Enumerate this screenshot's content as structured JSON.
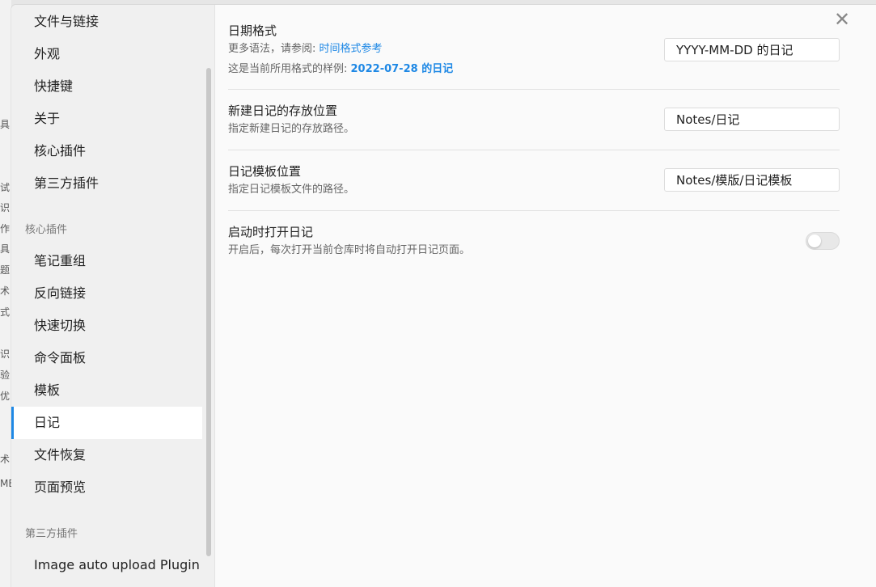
{
  "background_fragments": [
    "具",
    "试",
    "识",
    "作",
    "具",
    "题",
    "术",
    "式",
    "识",
    "验",
    "优",
    "术",
    "ME"
  ],
  "sidebar": {
    "top_items": [
      "文件与链接",
      "外观",
      "快捷键",
      "关于",
      "核心插件",
      "第三方插件"
    ],
    "core_plugins_label": "核心插件",
    "core_plugins": [
      "笔记重组",
      "反向链接",
      "快速切换",
      "命令面板",
      "模板",
      "日记",
      "文件恢复",
      "页面预览"
    ],
    "active_item": "日记",
    "third_party_label": "第三方插件",
    "third_party": [
      "Image auto upload Plugin"
    ]
  },
  "close_icon": "✕",
  "settings": {
    "date_format": {
      "title": "日期格式",
      "desc_prefix": "更多语法，请参阅: ",
      "desc_link": "时间格式参考",
      "sample_prefix": "这是当前所用格式的样例: ",
      "sample_value": "2022-07-28 的日记",
      "value": "YYYY-MM-DD 的日记"
    },
    "new_note_location": {
      "title": "新建日记的存放位置",
      "desc": "指定新建日记的存放路径。",
      "value": "Notes/日记"
    },
    "template_location": {
      "title": "日记模板位置",
      "desc": "指定日记模板文件的路径。",
      "value": "Notes/模版/日记模板"
    },
    "open_on_startup": {
      "title": "启动时打开日记",
      "desc": "开启后，每次打开当前仓库时将自动打开日记页面。",
      "enabled": false
    }
  },
  "colors": {
    "accent": "#1e88e5",
    "sidebar_bg": "#f0f0f0",
    "content_bg": "#fafafa"
  }
}
